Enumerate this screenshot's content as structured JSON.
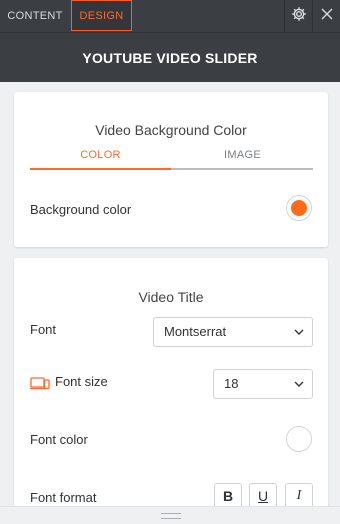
{
  "tabs": {
    "content": "CONTENT",
    "design": "DESIGN"
  },
  "header": {
    "title": "YOUTUBE VIDEO SLIDER"
  },
  "background_section": {
    "title": "Video Background Color",
    "subtabs": {
      "color": "COLOR",
      "image": "IMAGE"
    },
    "background_color_label": "Background color",
    "background_color_value": "#ff6a1a"
  },
  "title_section": {
    "title": "Video Title",
    "font_label": "Font",
    "font_value": "Montserrat",
    "font_size_label": "Font size",
    "font_size_value": "18",
    "font_color_label": "Font color",
    "font_color_value": "#ffffff",
    "font_format_label": "Font format",
    "format_buttons": {
      "bold": "B",
      "underline": "U",
      "italic": "I"
    }
  },
  "colors": {
    "accent": "#ff6a2b",
    "header_bg": "#3b3f44",
    "page_bg": "#eef0f2"
  },
  "icons": [
    "settings-gear-icon",
    "close-icon",
    "chevron-down-icon",
    "responsive-devices-icon",
    "resize-grip-icon"
  ]
}
